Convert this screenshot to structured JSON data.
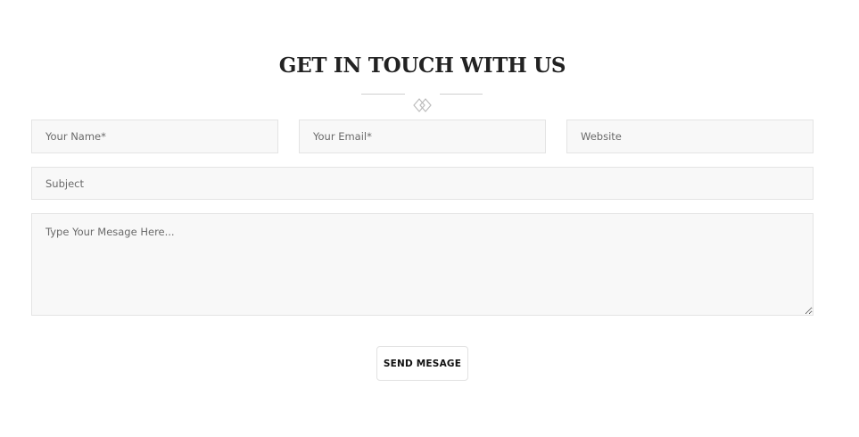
{
  "contact": {
    "heading": "GET IN TOUCH WITH US",
    "divider_icon": "double-diamond-icon",
    "fields": {
      "name": {
        "placeholder": "Your Name*",
        "value": ""
      },
      "email": {
        "placeholder": "Your Email*",
        "value": ""
      },
      "website": {
        "placeholder": "Website",
        "value": ""
      },
      "subject": {
        "placeholder": "Subject",
        "value": ""
      },
      "message": {
        "placeholder": "Type Your Mesage Here...",
        "value": ""
      }
    },
    "submit_label": "SEND MESAGE"
  },
  "colors": {
    "heading": "#222222",
    "field_background": "#f8f8f8",
    "field_border": "#e4e4e4",
    "divider": "#cfcfcf"
  }
}
